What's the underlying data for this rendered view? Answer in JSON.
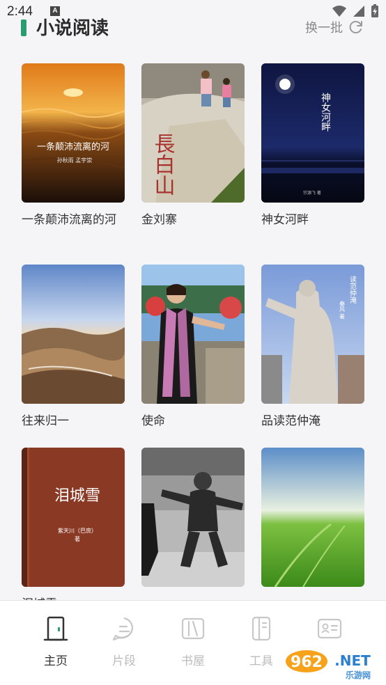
{
  "status": {
    "time": "2:44",
    "notif_letter": "A"
  },
  "header": {
    "title": "小说阅读",
    "refresh_label": "换一批"
  },
  "books": [
    {
      "title": "一条颠沛流离的河",
      "cover_text": "一条颠沛流离的河",
      "cover_sub": "孙秋雨 孟宇崇"
    },
    {
      "title": "金刘寨",
      "cover_text": "長白山"
    },
    {
      "title": "神女河畔",
      "cover_text": "神女河畔",
      "cover_sub": "宗源飞 著"
    },
    {
      "title": "往来归一"
    },
    {
      "title": "使命"
    },
    {
      "title": "品读范仲淹",
      "cover_text": "读范仲淹",
      "cover_sub": "秦风 著"
    },
    {
      "title": "泪城雪",
      "cover_text": "泪城雪",
      "cover_sub": "紫天川（巴庶）",
      "cover_sub2": "著"
    },
    {
      "title": ""
    },
    {
      "title": ""
    }
  ],
  "nav": [
    {
      "label": "主页",
      "icon": "home-door-icon",
      "active": true
    },
    {
      "label": "片段",
      "icon": "chat-bubble-icon",
      "active": false
    },
    {
      "label": "书屋",
      "icon": "bookshelf-icon",
      "active": false
    },
    {
      "label": "工具",
      "icon": "tools-icon",
      "active": false
    },
    {
      "label": "",
      "icon": "profile-card-icon",
      "active": false
    }
  ],
  "watermark": {
    "brand": "962",
    "suffix": ".NET",
    "sub": "乐游网"
  },
  "colors": {
    "accent": "#2a9d6f",
    "text": "#333333",
    "muted": "#bbbbbb"
  }
}
